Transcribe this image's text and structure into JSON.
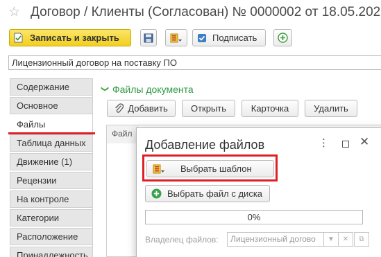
{
  "window": {
    "title": "Договор / Клиенты (Согласован) № 0000002 от 18.05.202"
  },
  "toolbar": {
    "save_close_label": "Записать и закрыть",
    "sign_label": "Подписать"
  },
  "description_value": "Лицензионный договор на поставку ПО",
  "side_tabs": [
    {
      "label": "Содержание"
    },
    {
      "label": "Основное"
    },
    {
      "label": "Файлы"
    },
    {
      "label": "Таблица данных"
    },
    {
      "label": "Движение (1)"
    },
    {
      "label": "Рецензии"
    },
    {
      "label": "На контроле"
    },
    {
      "label": "Категории"
    },
    {
      "label": "Расположение"
    },
    {
      "label": "Принадлежность"
    }
  ],
  "active_tab": "Файлы",
  "files": {
    "heading": "Файлы документа",
    "add_label": "Добавить",
    "open_label": "Открыть",
    "card_label": "Карточка",
    "delete_label": "Удалить",
    "column_header": "Файл"
  },
  "dialog": {
    "title": "Добавление файлов",
    "choose_template_label": "Выбрать шаблон",
    "choose_from_disk_label": "Выбрать файл с диска",
    "progress_percent": 0,
    "progress_text": "0%",
    "owner_label": "Владелец файлов:",
    "owner_value": "Лицензионный догово"
  },
  "colors": {
    "accent_yellow": "#f2cf1f",
    "heading_green": "#2e9a46",
    "highlight_red": "#dd1f26"
  },
  "icons": {
    "title": "star-icon",
    "save": "floppy-disk-icon",
    "template": "template-icon",
    "sign": "checkbox-icon",
    "create": "plus-circle-icon",
    "add": "paperclip-icon"
  }
}
